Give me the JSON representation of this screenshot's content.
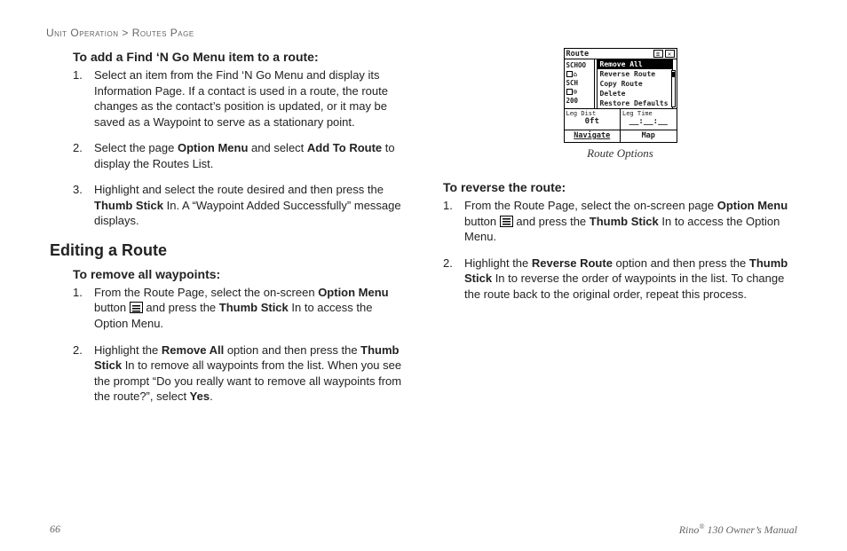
{
  "breadcrumb": {
    "section": "Unit Operation",
    "sep": " > ",
    "page": "Routes Page"
  },
  "left": {
    "proc1": {
      "title": "To add a Find ‘N Go Menu item to a route:",
      "steps": {
        "s1": {
          "n": "1.",
          "a": "Select an item from the Find ‘N Go Menu and display its Information Page. If a contact is used in a route, the route changes as the contact’s position is updated, or it may be saved as a Waypoint to serve as a stationary point."
        },
        "s2": {
          "n": "2.",
          "a": "Select the page ",
          "b": "Option Menu",
          "c": " and select ",
          "d": "Add To Route",
          "e": " to display the Routes List."
        },
        "s3": {
          "n": "3.",
          "a": "Highlight and select the route desired and then press the ",
          "b": "Thumb Stick",
          "c": " In. A “Waypoint Added Successfully” message displays."
        }
      }
    },
    "heading": "Editing a Route",
    "proc2": {
      "title": "To remove all waypoints:",
      "steps": {
        "s1": {
          "n": "1.",
          "a": "From the Route Page, select the on-screen ",
          "b": "Option Menu",
          "c": " button ",
          "d": " and press the ",
          "e": "Thumb Stick",
          "f": " In to access the Option Menu."
        },
        "s2": {
          "n": "2.",
          "a": "Highlight the ",
          "b": "Remove All",
          "c": " option and then press the ",
          "d": "Thumb Stick",
          "e": " In to remove all waypoints from the list. When you see the prompt “Do you really want to remove all waypoints from the route?”, select ",
          "f": "Yes",
          "g": "."
        }
      }
    }
  },
  "right": {
    "figure_caption": "Route Options",
    "device": {
      "title": "Route",
      "left_rows": {
        "r1": "SCHOO",
        "r2": "⌂ SCH",
        "r3": "⌾ 200"
      },
      "menu": {
        "o1": "Remove All",
        "o2": "Reverse Route",
        "o3": "Copy Route",
        "o4": "Delete",
        "o5": "Restore Defaults"
      },
      "stats": {
        "l1": "Leg Dist",
        "v1": "0ft",
        "l2": "Leg Time",
        "v2": "__:__:__"
      },
      "tabs": {
        "t1": "Navigate",
        "t2": "Map"
      }
    },
    "proc3": {
      "title": "To reverse the route:",
      "steps": {
        "s1": {
          "n": "1.",
          "a": "From the Route Page, select the on-screen page ",
          "b": "Option Menu",
          "c": " button ",
          "d": " and press the ",
          "e": "Thumb Stick",
          "f": " In to access the Option Menu."
        },
        "s2": {
          "n": "2.",
          "a": "Highlight the ",
          "b": "Reverse Route",
          "c": " option and then press the ",
          "d": "Thumb Stick",
          "e": " In to reverse the order of waypoints in the list. To change the route back to the original order, repeat this process."
        }
      }
    }
  },
  "footer": {
    "page_num": "66",
    "product_a": "Rino",
    "product_b": "®",
    "product_c": " 130 Owner’s Manual"
  }
}
